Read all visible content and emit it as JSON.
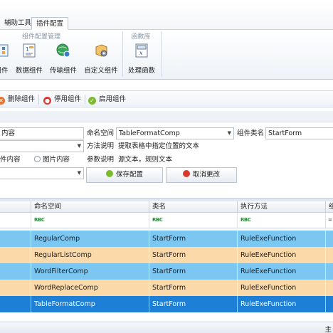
{
  "ribbon": {
    "tabs": [
      {
        "label": "辅助工具",
        "active": false
      },
      {
        "label": "插件配置",
        "active": true
      }
    ],
    "groups": [
      {
        "label": "组件配置管理"
      },
      {
        "label": "函数库"
      }
    ],
    "buttons": [
      {
        "label": "组件",
        "icon": "component-grid-icon"
      },
      {
        "label": "数据组件",
        "icon": "data-component-icon"
      },
      {
        "label": "传输组件",
        "icon": "globe-transfer-icon"
      },
      {
        "label": "自定义组件",
        "icon": "custom-component-icon"
      },
      {
        "label": "处理函数",
        "icon": "function-calculator-icon"
      }
    ]
  },
  "toolbar": {
    "delete_label": "删除组件",
    "disable_label": "停用组件",
    "enable_label": "启用组件"
  },
  "form": {
    "content_field_value": "内容",
    "namespace_label": "命名空间",
    "namespace_value": "TableFormatComp",
    "classname_label": "组件类名",
    "classname_value": "StartForm",
    "method_desc_label": "方法说明",
    "method_desc_value": "提取表格中指定位置的文本",
    "radio_text_label": "件内容",
    "radio_image_label": "图片内容",
    "param_desc_label": "参数说明",
    "param_desc_value": "源文本，规则文本",
    "save_button": "保存配置",
    "cancel_button": "取消更改"
  },
  "grid": {
    "columns": [
      "命名空间",
      "类名",
      "执行方法",
      "组"
    ],
    "filter_glyph": "RBC",
    "rows": [
      {
        "namespace": "RegularComp",
        "class": "StartForm",
        "method": "RuleExeFunction",
        "color": "#7cc6f2",
        "selected": false
      },
      {
        "namespace": "RegularListComp",
        "class": "StartForm",
        "method": "RuleExeFunction",
        "color": "#fcd9a8",
        "selected": false
      },
      {
        "namespace": "WordFilterComp",
        "class": "StartForm",
        "method": "RuleExeFunction",
        "color": "#7cc6f2",
        "selected": false
      },
      {
        "namespace": "WordReplaceComp",
        "class": "StartForm",
        "method": "RuleExeFunction",
        "color": "#fcd9a8",
        "selected": false
      },
      {
        "namespace": "TableFormatComp",
        "class": "StartForm",
        "method": "RuleExeFunction",
        "color": "#1e7fd6",
        "selected": true
      }
    ]
  },
  "status": {
    "right_text": "主"
  }
}
